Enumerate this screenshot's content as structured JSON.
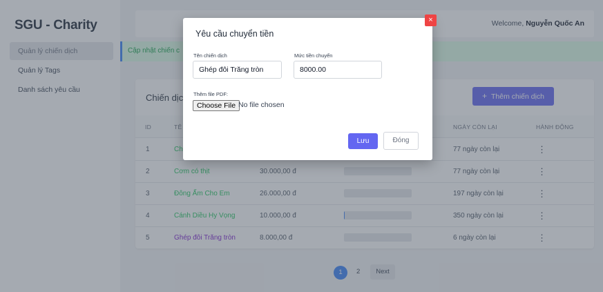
{
  "sidebar": {
    "brand": "SGU - Charity",
    "items": [
      {
        "label": "Quản lý chiến dịch",
        "active": true
      },
      {
        "label": "Quản lý Tags",
        "active": false
      },
      {
        "label": "Danh sách yêu cầu",
        "active": false
      }
    ]
  },
  "header": {
    "welcome_prefix": "Welcome,",
    "user_name": "Nguyễn Quốc An"
  },
  "alert": {
    "text": "Cập nhật chiến c"
  },
  "campaigns": {
    "title": "Chiến dịch",
    "add_button": "Thêm chiến dịch",
    "columns": [
      "ID",
      "TÊ",
      "NGÀY CÒN LẠI",
      "HÀNH ĐỘNG"
    ],
    "rows": [
      {
        "id": "1",
        "name": "Ch",
        "amount": "",
        "progress": 0.0,
        "days": "77 ngày còn lại"
      },
      {
        "id": "2",
        "name": "Cơm có thịt",
        "amount": "30.000,00 đ",
        "progress": 0.0,
        "days": "77 ngày còn lại"
      },
      {
        "id": "3",
        "name": "Đông Ấm Cho Em",
        "amount": "26.000,00 đ",
        "progress": 0.0,
        "days": "197 ngày còn lại"
      },
      {
        "id": "4",
        "name": "Cánh Diều Hy Vọng",
        "amount": "10.000,00 đ",
        "progress": 0.01,
        "days": "350 ngày còn lại"
      },
      {
        "id": "5",
        "name": "Ghép đôi Trăng tròn",
        "amount": "8.000,00 đ",
        "progress": 0.0,
        "days": "6 ngày còn lại"
      }
    ],
    "action_icon": "kebab-menu-icon"
  },
  "pagination": {
    "pages": [
      "1",
      "2"
    ],
    "current": "1",
    "next": "Next"
  },
  "modal": {
    "title": "Yêu cầu chuyển tiền",
    "campaign_label": "Tên chiến dịch",
    "campaign_value": "Ghép đôi Trăng tròn",
    "amount_label": "Mức tiền chuyển",
    "amount_value": "8000.00",
    "pdf_label": "Thêm file PDF:",
    "file_button": "Choose File",
    "file_status": "No file chosen",
    "save": "Lưu",
    "cancel": "Đóng",
    "close_icon": "×"
  },
  "colors": {
    "accent": "#6366f1",
    "link_green": "#22c55e",
    "pagination_active": "#3b82f6",
    "close_red": "#ef4444"
  }
}
